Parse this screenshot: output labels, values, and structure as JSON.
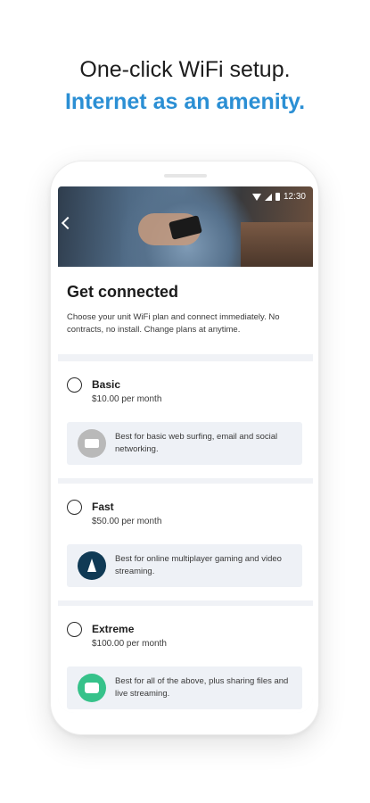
{
  "headline": {
    "line1": "One-click WiFi setup.",
    "line2": "Internet as an amenity."
  },
  "status_bar": {
    "time": "12:30"
  },
  "screen": {
    "title": "Get connected",
    "description": "Choose your unit WiFi plan and connect immediately. No contracts, no install. Change plans at anytime."
  },
  "plans": [
    {
      "name": "Basic",
      "price": "$10.00 per month",
      "note": "Best for basic web surfing, email and social networking.",
      "icon": "router-icon"
    },
    {
      "name": "Fast",
      "price": "$50.00 per month",
      "note": "Best for online multiplayer gaming and video streaming.",
      "icon": "rocket-icon"
    },
    {
      "name": "Extreme",
      "price": "$100.00 per month",
      "note": "Best for all of the above, plus sharing files and live streaming.",
      "icon": "media-icon"
    }
  ],
  "colors": {
    "accent": "#2b8fd4",
    "basic_icon": "#b9b9b9",
    "fast_icon": "#103a55",
    "extreme_icon": "#36c28a"
  }
}
